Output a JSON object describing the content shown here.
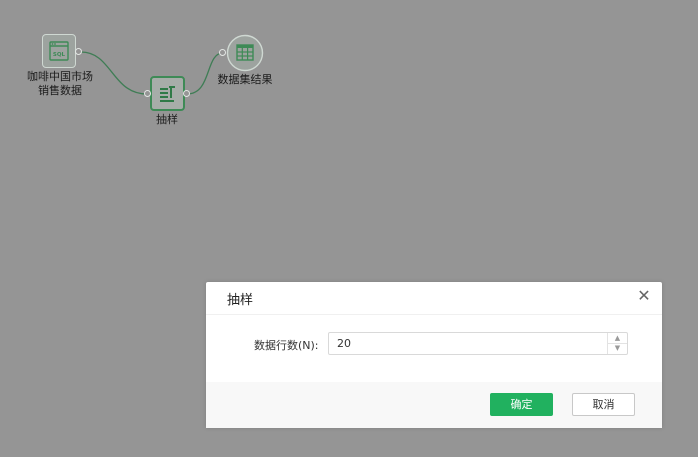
{
  "flow": {
    "nodes": [
      {
        "id": "source",
        "label": "咖啡中国市场\n销售数据",
        "icon": "sql-table-icon"
      },
      {
        "id": "sample",
        "label": "抽样",
        "icon": "sampling-icon"
      },
      {
        "id": "result",
        "label": "数据集结果",
        "icon": "grid-table-icon"
      }
    ],
    "icon_text": {
      "sql": "SQL"
    }
  },
  "dialog": {
    "title": "抽样",
    "close_icon": "close-icon",
    "field_label": "数据行数(N):",
    "rows_value": "20",
    "ok_label": "确定",
    "cancel_label": "取消"
  },
  "colors": {
    "overlay": "#959595",
    "accent_green": "#21b15f",
    "node_green": "#3e8a56",
    "connector": "#3f7d55"
  }
}
